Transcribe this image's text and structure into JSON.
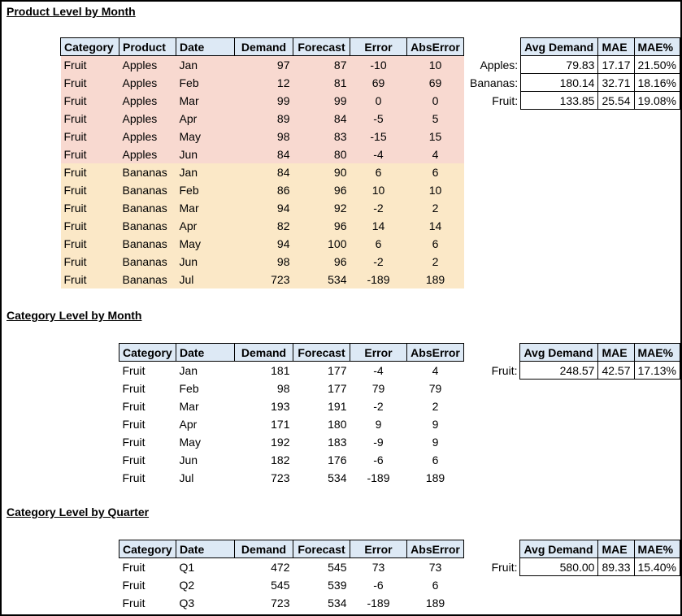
{
  "titles": {
    "product_month": "Product Level by Month",
    "category_month": "Category Level by Month",
    "category_quarter": "Category Level by Quarter"
  },
  "product_table": {
    "headers": [
      "Category",
      "Product",
      "Date",
      "Demand",
      "Forecast",
      "Error",
      "AbsError"
    ],
    "rows": [
      [
        "Fruit",
        "Apples",
        "Jan",
        "97",
        "87",
        "-10",
        "10"
      ],
      [
        "Fruit",
        "Apples",
        "Feb",
        "12",
        "81",
        "69",
        "69"
      ],
      [
        "Fruit",
        "Apples",
        "Mar",
        "99",
        "99",
        "0",
        "0"
      ],
      [
        "Fruit",
        "Apples",
        "Apr",
        "89",
        "84",
        "-5",
        "5"
      ],
      [
        "Fruit",
        "Apples",
        "May",
        "98",
        "83",
        "-15",
        "15"
      ],
      [
        "Fruit",
        "Apples",
        "Jun",
        "84",
        "80",
        "-4",
        "4"
      ],
      [
        "Fruit",
        "Bananas",
        "Jan",
        "84",
        "90",
        "6",
        "6"
      ],
      [
        "Fruit",
        "Bananas",
        "Feb",
        "86",
        "96",
        "10",
        "10"
      ],
      [
        "Fruit",
        "Bananas",
        "Mar",
        "94",
        "92",
        "-2",
        "2"
      ],
      [
        "Fruit",
        "Bananas",
        "Apr",
        "82",
        "96",
        "14",
        "14"
      ],
      [
        "Fruit",
        "Bananas",
        "May",
        "94",
        "100",
        "6",
        "6"
      ],
      [
        "Fruit",
        "Bananas",
        "Jun",
        "98",
        "96",
        "-2",
        "2"
      ],
      [
        "Fruit",
        "Bananas",
        "Jul",
        "723",
        "534",
        "-189",
        "189"
      ]
    ],
    "row_colors": {
      "Apples": "#f8d9d0",
      "Bananas": "#fbe8c7"
    }
  },
  "product_summary": {
    "headers": [
      "Avg Demand",
      "MAE",
      "MAE%"
    ],
    "rows": [
      [
        "Apples:",
        "79.83",
        "17.17",
        "21.50%"
      ],
      [
        "Bananas:",
        "180.14",
        "32.71",
        "18.16%"
      ],
      [
        "Fruit:",
        "133.85",
        "25.54",
        "19.08%"
      ]
    ]
  },
  "category_month_table": {
    "headers": [
      "Category",
      "Date",
      "Demand",
      "Forecast",
      "Error",
      "AbsError"
    ],
    "rows": [
      [
        "Fruit",
        "Jan",
        "181",
        "177",
        "-4",
        "4"
      ],
      [
        "Fruit",
        "Feb",
        "98",
        "177",
        "79",
        "79"
      ],
      [
        "Fruit",
        "Mar",
        "193",
        "191",
        "-2",
        "2"
      ],
      [
        "Fruit",
        "Apr",
        "171",
        "180",
        "9",
        "9"
      ],
      [
        "Fruit",
        "May",
        "192",
        "183",
        "-9",
        "9"
      ],
      [
        "Fruit",
        "Jun",
        "182",
        "176",
        "-6",
        "6"
      ],
      [
        "Fruit",
        "Jul",
        "723",
        "534",
        "-189",
        "189"
      ]
    ]
  },
  "category_month_summary": {
    "headers": [
      "Avg Demand",
      "MAE",
      "MAE%"
    ],
    "rows": [
      [
        "Fruit:",
        "248.57",
        "42.57",
        "17.13%"
      ]
    ]
  },
  "category_quarter_table": {
    "headers": [
      "Category",
      "Date",
      "Demand",
      "Forecast",
      "Error",
      "AbsError"
    ],
    "rows": [
      [
        "Fruit",
        "Q1",
        "472",
        "545",
        "73",
        "73"
      ],
      [
        "Fruit",
        "Q2",
        "545",
        "539",
        "-6",
        "6"
      ],
      [
        "Fruit",
        "Q3",
        "723",
        "534",
        "-189",
        "189"
      ]
    ]
  },
  "category_quarter_summary": {
    "headers": [
      "Avg Demand",
      "MAE",
      "MAE%"
    ],
    "rows": [
      [
        "Fruit:",
        "580.00",
        "89.33",
        "15.40%"
      ]
    ]
  },
  "colors": {
    "header_fill": "#dde9f5"
  }
}
